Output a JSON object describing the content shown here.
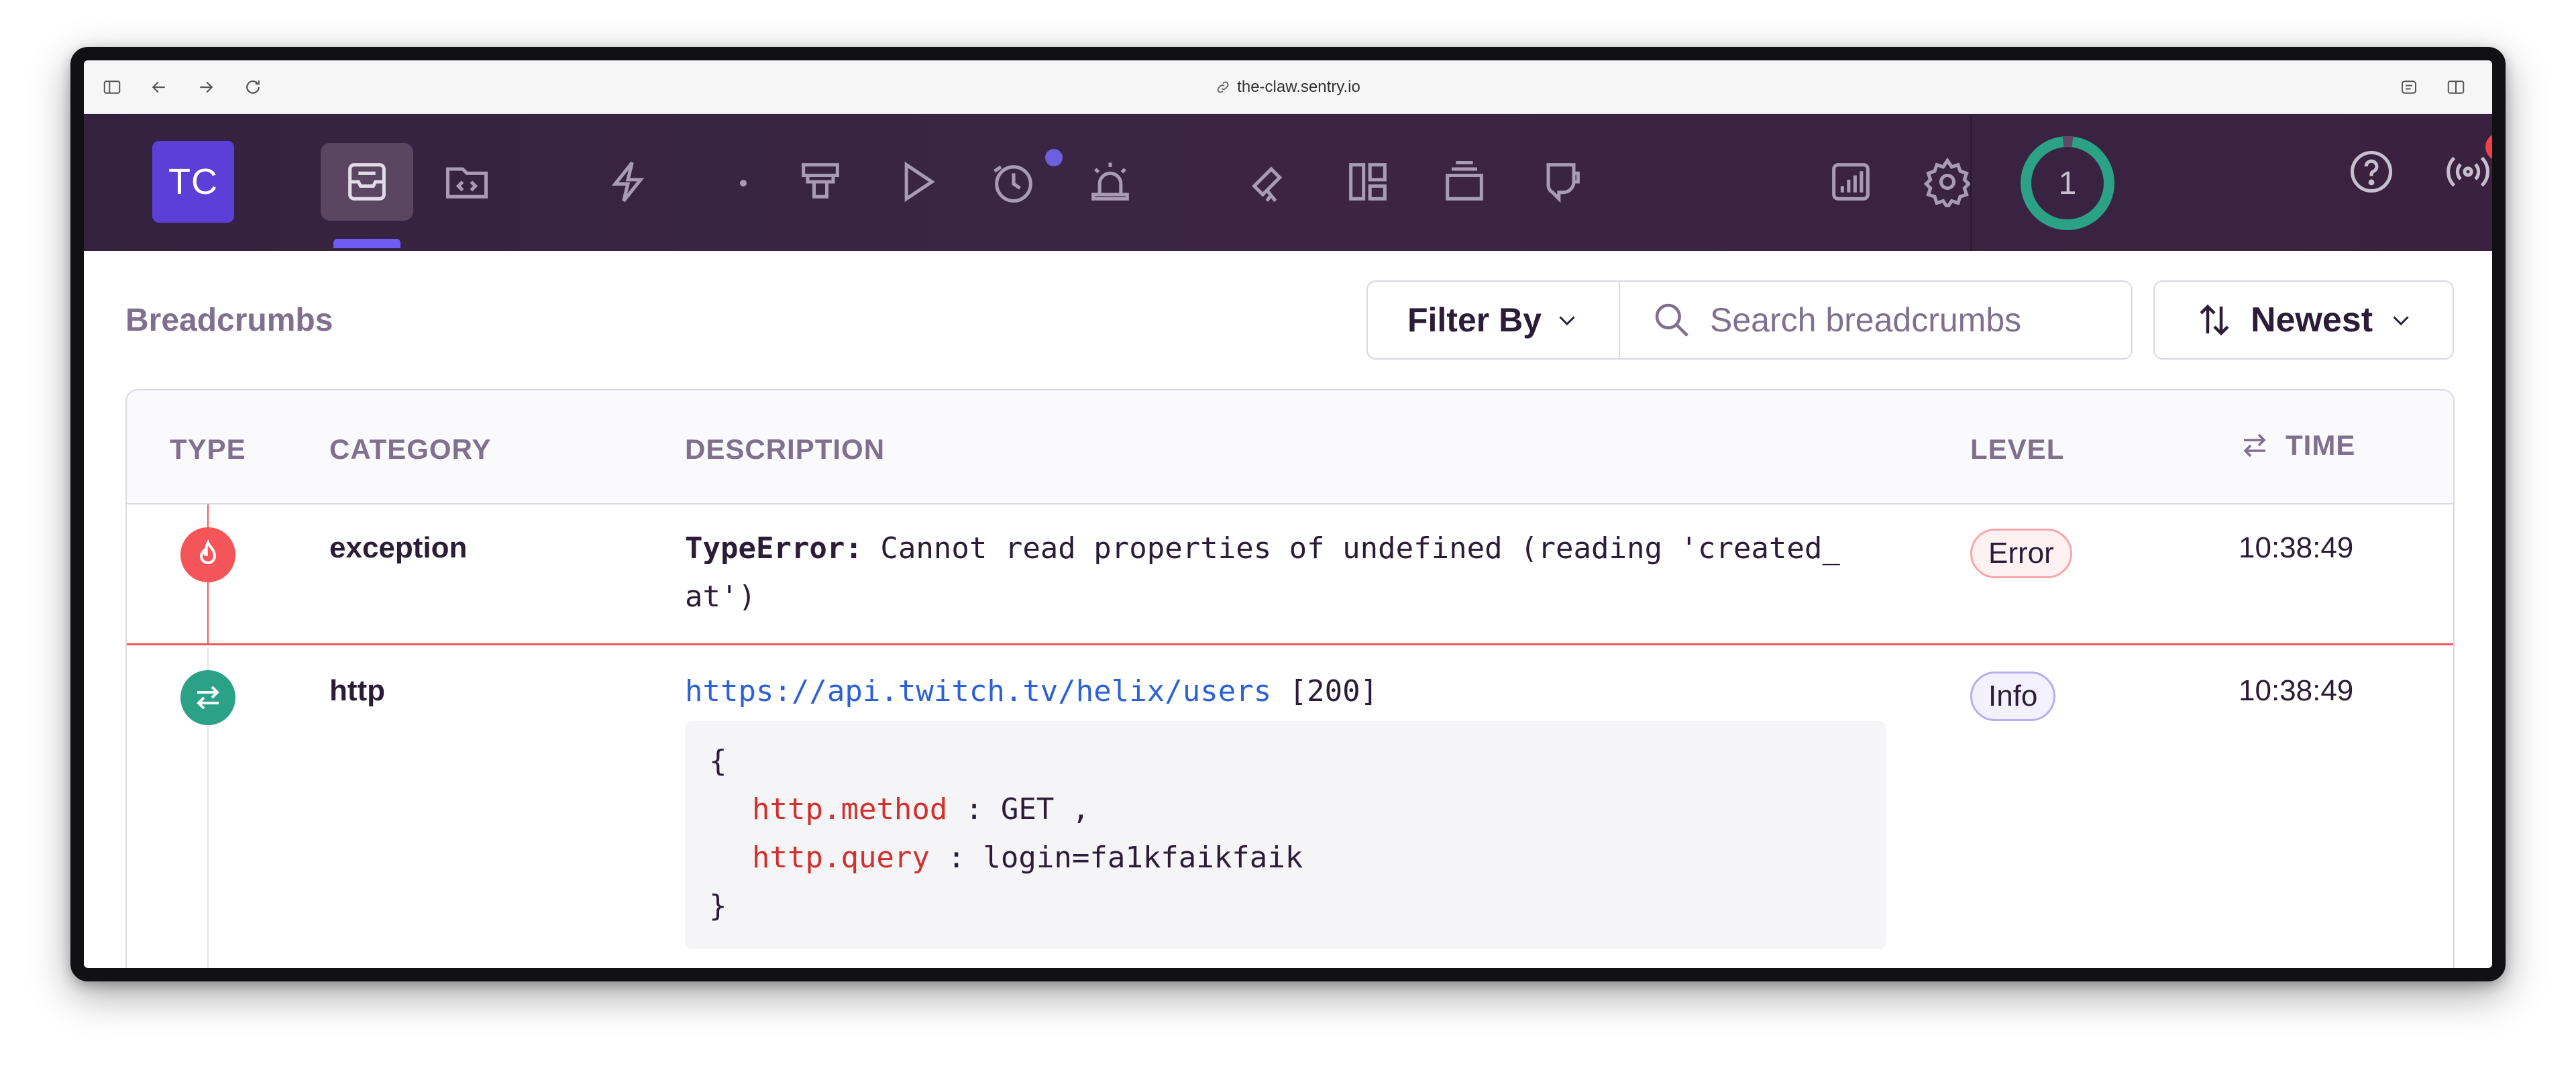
{
  "browser": {
    "url": "the-claw.sentry.io"
  },
  "nav": {
    "avatar_initials": "TC",
    "icons": [
      "issues-icon",
      "projects-icon",
      "performance-icon",
      "dot-separator",
      "releases-icon",
      "replays-icon",
      "crons-icon",
      "alerts-icon",
      "discover-icon",
      "dashboards-icon",
      "archive-icon",
      "feedback-icon",
      "stats-icon",
      "settings-icon"
    ],
    "onboarding_progress": "1",
    "help_icon": "help-icon",
    "broadcast_icon": "broadcast-icon"
  },
  "breadcrumbs": {
    "title": "Breadcrumbs",
    "filter_label": "Filter By",
    "search_placeholder": "Search breadcrumbs",
    "sort_label": "Newest",
    "headers": {
      "type": "TYPE",
      "category": "CATEGORY",
      "description": "DESCRIPTION",
      "level": "LEVEL",
      "time": "TIME"
    },
    "rows": [
      {
        "type_icon": "fire-icon",
        "category": "exception",
        "desc_prefix": "TypeError:",
        "desc_line1": " Cannot read properties of undefined (reading 'created_",
        "desc_line2": "at')",
        "level": "Error",
        "time": "10:38:49"
      },
      {
        "type_icon": "swap-icon",
        "category": "http",
        "url": "https://api.twitch.tv/helix/users",
        "status": "[200]",
        "data_open": "{",
        "method_key": "http.method",
        "method_sep": ":",
        "method_val": "GET ,",
        "query_key": "http.query",
        "query_sep": ":",
        "query_val": "login=fa1kfaikfaik",
        "data_close": "}",
        "level": "Info",
        "time": "10:38:49"
      }
    ]
  },
  "colors": {
    "nav_bg": "#3a2343",
    "accent": "#6c5fe0",
    "error": "#f55459",
    "success": "#2ba185"
  }
}
